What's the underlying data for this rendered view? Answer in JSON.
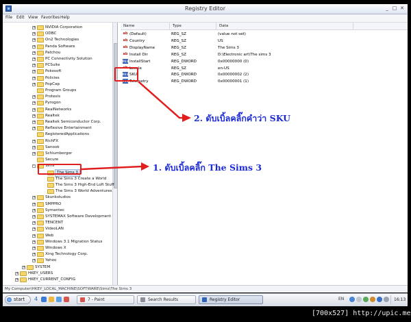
{
  "window": {
    "title": "Registry Editor",
    "controls": [
      "_",
      "□",
      "✕"
    ]
  },
  "menubar": [
    "File",
    "Edit",
    "View",
    "Favorites",
    "Help"
  ],
  "tree": {
    "nodes": [
      {
        "label": "NVIDIA Corporation",
        "level": 3,
        "expander": "+"
      },
      {
        "label": "ODBC",
        "level": 3,
        "expander": "+"
      },
      {
        "label": "On2 Technologies",
        "level": 3,
        "expander": "+"
      },
      {
        "label": "Panda Software",
        "level": 3,
        "expander": "+"
      },
      {
        "label": "Patchou",
        "level": 3,
        "expander": "+"
      },
      {
        "label": "PC Connectivity Solution",
        "level": 3,
        "expander": "+"
      },
      {
        "label": "PCSuite",
        "level": 3,
        "expander": "+"
      },
      {
        "label": "Pokosoft",
        "level": 3,
        "expander": "+"
      },
      {
        "label": "Policies",
        "level": 3,
        "expander": "+"
      },
      {
        "label": "PopCap",
        "level": 3,
        "expander": "+"
      },
      {
        "label": "Program Groups",
        "level": 3,
        "expander": ""
      },
      {
        "label": "Protexis",
        "level": 3,
        "expander": "+"
      },
      {
        "label": "Pyrogon",
        "level": 3,
        "expander": "+"
      },
      {
        "label": "RealNetworks",
        "level": 3,
        "expander": "+"
      },
      {
        "label": "Realtek",
        "level": 3,
        "expander": "+"
      },
      {
        "label": "Realtek Semiconductor Corp.",
        "level": 3,
        "expander": "+"
      },
      {
        "label": "Reflexive Entertainment",
        "level": 3,
        "expander": "+"
      },
      {
        "label": "RegisteredApplications",
        "level": 3,
        "expander": ""
      },
      {
        "label": "RichFX",
        "level": 3,
        "expander": "+"
      },
      {
        "label": "Sanook",
        "level": 3,
        "expander": "+"
      },
      {
        "label": "Schlumberger",
        "level": 3,
        "expander": "+"
      },
      {
        "label": "Secure",
        "level": 3,
        "expander": ""
      },
      {
        "label": "Sims",
        "level": 3,
        "expander": "-"
      },
      {
        "label": "The Sims 3",
        "level": 4,
        "expander": "",
        "selected": true
      },
      {
        "label": "The Sims 3 Create a World",
        "level": 4,
        "expander": ""
      },
      {
        "label": "The Sims 3 High-End Loft Stuff",
        "level": 4,
        "expander": ""
      },
      {
        "label": "The Sims 3 World Adventures",
        "level": 4,
        "expander": ""
      },
      {
        "label": "Skunkstudios",
        "level": 3,
        "expander": "+"
      },
      {
        "label": "SMPPRO",
        "level": 3,
        "expander": "+"
      },
      {
        "label": "Symantec",
        "level": 3,
        "expander": "+"
      },
      {
        "label": "SYSTEMAX Software Development",
        "level": 3,
        "expander": "+"
      },
      {
        "label": "TENCENT",
        "level": 3,
        "expander": "+"
      },
      {
        "label": "VideoLAN",
        "level": 3,
        "expander": "+"
      },
      {
        "label": "Web",
        "level": 3,
        "expander": "+"
      },
      {
        "label": "Windows 3.1 Migration Status",
        "level": 3,
        "expander": "+"
      },
      {
        "label": "Windows X",
        "level": 3,
        "expander": "+"
      },
      {
        "label": "Xing Technology Corp.",
        "level": 3,
        "expander": "+"
      },
      {
        "label": "Yahoo",
        "level": 3,
        "expander": "+"
      },
      {
        "label": "SYSTEM",
        "level": 2,
        "expander": "+"
      },
      {
        "label": "HKEY_USERS",
        "level": 1,
        "expander": "+"
      },
      {
        "label": "HKEY_CURRENT_CONFIG",
        "level": 1,
        "expander": "+"
      }
    ]
  },
  "list": {
    "columns": [
      "Name",
      "Type",
      "Data"
    ],
    "rows": [
      {
        "name": "(Default)",
        "type": "REG_SZ",
        "data": "(value not set)",
        "icon": "string-value-icon"
      },
      {
        "name": "Country",
        "type": "REG_SZ",
        "data": "US",
        "icon": "string-value-icon"
      },
      {
        "name": "DisplayName",
        "type": "REG_SZ",
        "data": "The Sims 3",
        "icon": "string-value-icon"
      },
      {
        "name": "Install Dir",
        "type": "REG_SZ",
        "data": "D:\\Electronic art\\The sims 3",
        "icon": "string-value-icon"
      },
      {
        "name": "InstallStart",
        "type": "REG_DWORD",
        "data": "0x00000000 (0)",
        "icon": "dword-value-icon"
      },
      {
        "name": "Locale",
        "type": "REG_SZ",
        "data": "en-US",
        "icon": "string-value-icon"
      },
      {
        "name": "SKU",
        "type": "REG_DWORD",
        "data": "0x00000002 (2)",
        "icon": "dword-value-icon"
      },
      {
        "name": "Telemetry",
        "type": "REG_DWORD",
        "data": "0x00000001 (1)",
        "icon": "dword-value-icon"
      }
    ]
  },
  "statusbar": {
    "path": "My Computer\\HKEY_LOCAL_MACHINE\\SOFTWARE\\Sims\\The Sims 3"
  },
  "annotations": {
    "step1": "1. ดับเบิ้ลคลิ๊ก The Sims 3",
    "step2": "2. ดับเบิ้ลคลิ๊กคำว่า SKU",
    "color": "#e01e1e",
    "text_color": "#1c2bd6"
  },
  "taskbar": {
    "start_label": "start",
    "quicklaunch_count": "4",
    "tasks": [
      {
        "label": "7 - Paint",
        "active": false,
        "icon_color": "#d9534f"
      },
      {
        "label": "Search Results",
        "active": false,
        "icon_color": "#8a8f99"
      },
      {
        "label": "Registry Editor",
        "active": true,
        "icon_color": "#2e64b8"
      }
    ],
    "language": "EN",
    "clock": "16:13"
  },
  "watermark": "[700x527] http://upic.me/"
}
